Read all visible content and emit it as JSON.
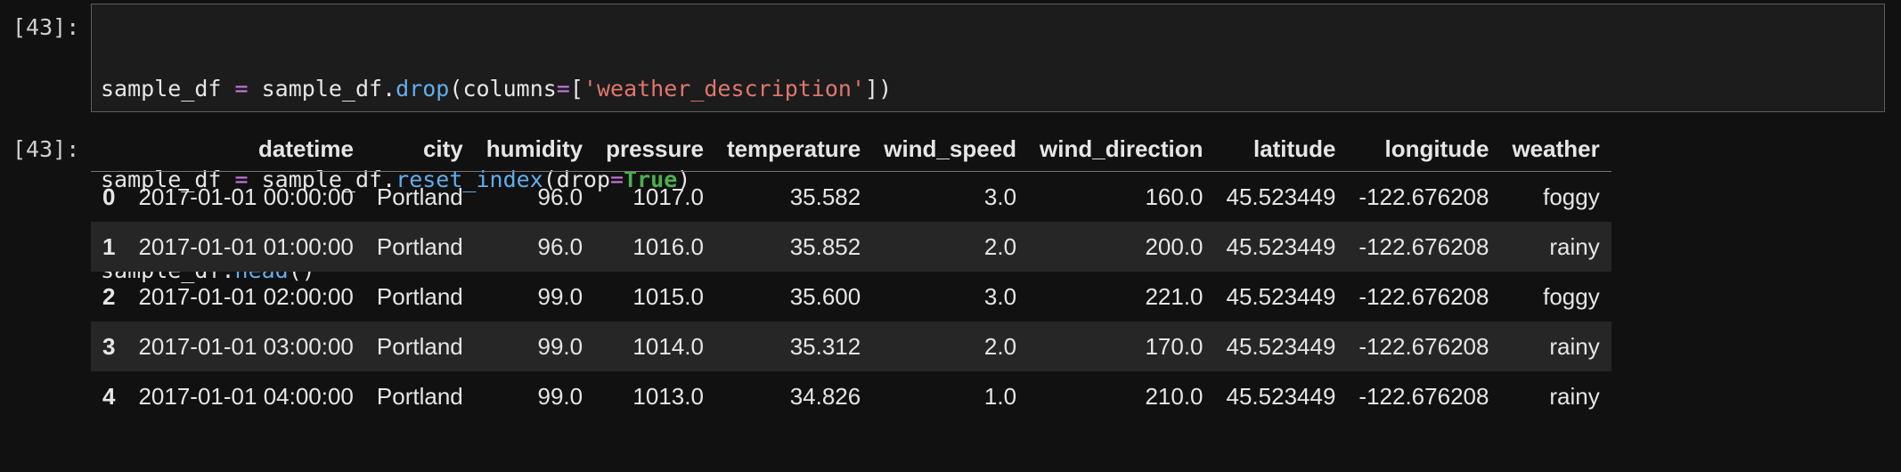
{
  "input_prompt": "[43]:",
  "output_prompt": "[43]:",
  "code": {
    "line1": {
      "var": "sample_df",
      "eq": " = ",
      "obj": "sample_df",
      "dot": ".",
      "fn": "drop",
      "open": "(",
      "kw_name": "columns",
      "kw_eq": "=",
      "bracket_open": "[",
      "str": "'weather_description'",
      "bracket_close": "]",
      "close": ")"
    },
    "line2": {
      "var": "sample_df",
      "eq": " = ",
      "obj": "sample_df",
      "dot": ".",
      "fn": "reset_index",
      "open": "(",
      "kw_name": "drop",
      "kw_eq": "=",
      "kw_value": "True",
      "close": ")"
    },
    "line3": {
      "obj": "sample_df",
      "dot": ".",
      "fn": "head",
      "call": "()"
    }
  },
  "table": {
    "columns": [
      "",
      "datetime",
      "city",
      "humidity",
      "pressure",
      "temperature",
      "wind_speed",
      "wind_direction",
      "latitude",
      "longitude",
      "weather"
    ],
    "rows": [
      [
        "0",
        "2017-01-01 00:00:00",
        "Portland",
        "96.0",
        "1017.0",
        "35.582",
        "3.0",
        "160.0",
        "45.523449",
        "-122.676208",
        "foggy"
      ],
      [
        "1",
        "2017-01-01 01:00:00",
        "Portland",
        "96.0",
        "1016.0",
        "35.852",
        "2.0",
        "200.0",
        "45.523449",
        "-122.676208",
        "rainy"
      ],
      [
        "2",
        "2017-01-01 02:00:00",
        "Portland",
        "99.0",
        "1015.0",
        "35.600",
        "3.0",
        "221.0",
        "45.523449",
        "-122.676208",
        "foggy"
      ],
      [
        "3",
        "2017-01-01 03:00:00",
        "Portland",
        "99.0",
        "1014.0",
        "35.312",
        "2.0",
        "170.0",
        "45.523449",
        "-122.676208",
        "rainy"
      ],
      [
        "4",
        "2017-01-01 04:00:00",
        "Portland",
        "99.0",
        "1013.0",
        "34.826",
        "1.0",
        "210.0",
        "45.523449",
        "-122.676208",
        "rainy"
      ]
    ]
  },
  "colors": {
    "background": "#111111",
    "code_background": "#1c1c1c",
    "operator": "#c678dd",
    "function": "#61aeee",
    "string": "#e0766e",
    "keyword": "#4caf50"
  }
}
